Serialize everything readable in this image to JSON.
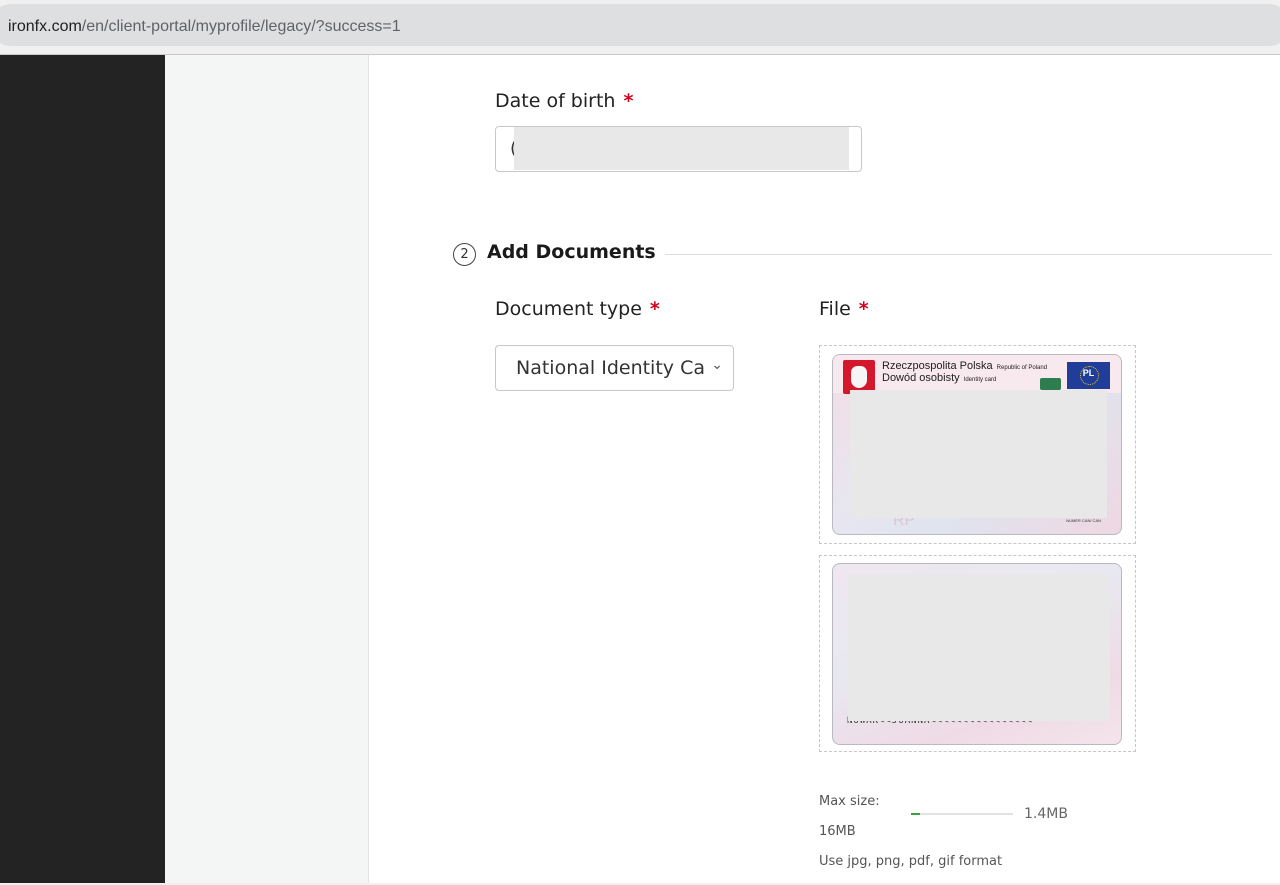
{
  "browser": {
    "url_host": "ironfx.com",
    "url_path": "/en/client-portal/myprofile/legacy/?success=1"
  },
  "form": {
    "dob": {
      "label": "Date of birth",
      "required_mark": "*",
      "value_partial": "("
    },
    "section": {
      "step_number": "2",
      "title": "Add Documents"
    },
    "document_type": {
      "label": "Document type",
      "required_mark": "*",
      "selected": "National Identity Card"
    },
    "file": {
      "label": "File",
      "required_mark": "*"
    },
    "id_card": {
      "country_name": "Rzeczpospolita Polska",
      "country_name_en": "Republic of Poland",
      "doc_name": "Dowód osobisty",
      "doc_name_en": "Identity card",
      "country_code": "PL",
      "can_label": "NUMER CAN/ CAN",
      "mrz_tail": "NOWAK<<JOANNA<<<<<<<<<<<<<<<<"
    },
    "upload": {
      "max_size_label": "Max size:",
      "max_size_value": "16MB",
      "uploaded_size": "1.4MB",
      "progress_fraction": 0.0875,
      "format_hint": "Use jpg, png, pdf, gif format"
    }
  },
  "colors": {
    "required": "#d0021b",
    "progress": "#3aa53f",
    "sidebar": "#232323"
  }
}
